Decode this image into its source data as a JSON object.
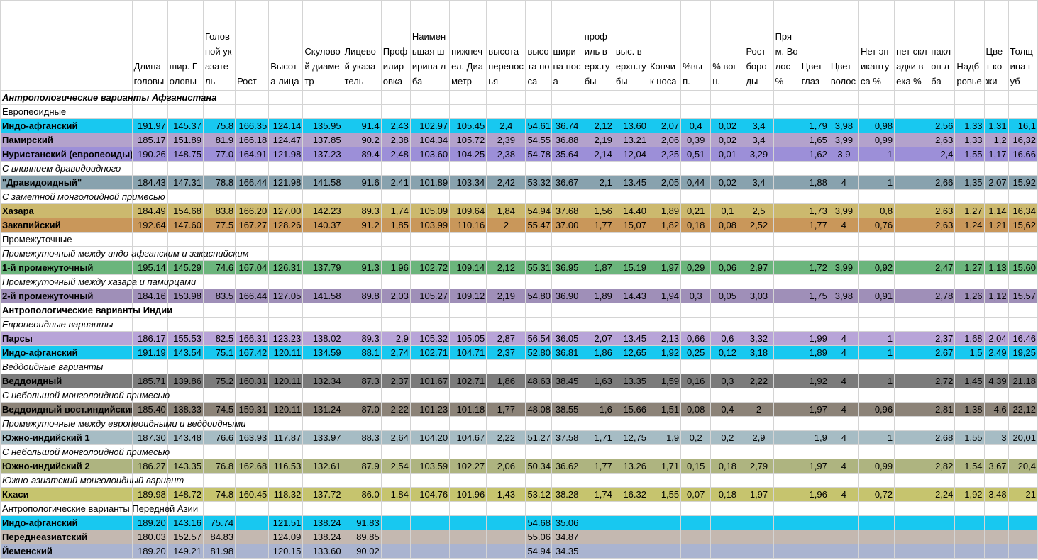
{
  "headers": [
    "",
    "Длина головы",
    "шир. Головы",
    "Головной указатель",
    "Рост",
    "Высота лица",
    "Скуловой диаметр",
    "Лицевой указатель",
    "Профилировка",
    "Наименьшая ширина лба",
    "нижнечел. Диаметр",
    "высота переносья",
    "высота носа",
    "ширина носа",
    "профиль верх.губы",
    "выс. верхн.губы",
    "Кончик носа",
    "%вып.",
    "% вогн.",
    "Рост бороды",
    "Прям. Волос %",
    "Цвет глаз",
    "Цвет волос",
    "Нет эпикантуса %",
    "нет складки века %",
    "наклон лба",
    "Надбровье",
    "Цвет кожи",
    "Толщина губ"
  ],
  "rows": [
    {
      "kind": "title",
      "label": "Антропологические варианты Афганистана"
    },
    {
      "kind": "plain",
      "label": "Европеоидные"
    },
    {
      "kind": "data",
      "color": "#18c8f0",
      "cells": [
        "Индо-афганский",
        "191.97",
        "145.37",
        "75.8",
        "166.35",
        "124.14",
        "135.95",
        "91.4",
        "2,43",
        "102.97",
        "105.45",
        "2,4",
        "54.61",
        "36.74",
        "2,12",
        "13.60",
        "2,07",
        "0,4",
        "0,02",
        "3,4",
        "",
        "1,79",
        "3,98",
        "0,98",
        "",
        "2,56",
        "1,33",
        "1,31",
        "16,1"
      ]
    },
    {
      "kind": "data",
      "color": "#b3a2cc",
      "cells": [
        "Памирский",
        "185.17",
        "151.89",
        "81.9",
        "166.18",
        "124.47",
        "137.85",
        "90.2",
        "2,38",
        "104.34",
        "105.72",
        "2,39",
        "54.55",
        "36.88",
        "2,19",
        "13.21",
        "2,06",
        "0,39",
        "0,02",
        "3,4",
        "",
        "1,65",
        "3,99",
        "0,99",
        "",
        "2,63",
        "1,33",
        "1,2",
        "16,32"
      ]
    },
    {
      "kind": "data",
      "color": "#9c8fd8",
      "cells": [
        "Нуристанский (европеоиды)",
        "190.26",
        "148.75",
        "77.0",
        "164.91",
        "121.98",
        "137.23",
        "89.4",
        "2,48",
        "103.60",
        "104.25",
        "2,38",
        "54.78",
        "35.64",
        "2,14",
        "12,04",
        "2,25",
        "0,51",
        "0,01",
        "3,29",
        "",
        "1,62",
        "3,9",
        "1",
        "",
        "2,4",
        "1,55",
        "1,17",
        "16.66"
      ]
    },
    {
      "kind": "italic",
      "label": "С влиянием дравидоидного"
    },
    {
      "kind": "data",
      "color": "#88a2ae",
      "cells": [
        "\"Дравидоидный\"",
        "184.43",
        "147.31",
        "78.8",
        "166.44",
        "121.98",
        "141.58",
        "91.6",
        "2,41",
        "101.89",
        "103.34",
        "2,42",
        "53.32",
        "36.67",
        "2,1",
        "13.45",
        "2,05",
        "0,44",
        "0,02",
        "3,4",
        "",
        "1,88",
        "4",
        "1",
        "",
        "2,66",
        "1,35",
        "2,07",
        "15.92"
      ]
    },
    {
      "kind": "italic",
      "label": "С заметной монголоидной примесью"
    },
    {
      "kind": "data",
      "color": "#ccb96e",
      "cells": [
        "Хазара",
        "184.49",
        "154.68",
        "83.8",
        "166.20",
        "127.00",
        "142.23",
        "89.3",
        "1,74",
        "105.09",
        "109.64",
        "1,84",
        "54.94",
        "37.68",
        "1,56",
        "14.40",
        "1,89",
        "0,21",
        "0,1",
        "2,5",
        "",
        "1,73",
        "3,99",
        "0,8",
        "",
        "2,63",
        "1,27",
        "1,14",
        "16,34"
      ]
    },
    {
      "kind": "data",
      "color": "#c9975a",
      "cells": [
        "Закапийский",
        "192.64",
        "147.60",
        "77.5",
        "167.27",
        "128.26",
        "140.37",
        "91.2",
        "1,85",
        "103.99",
        "110.16",
        "2",
        "55.47",
        "37.00",
        "1,77",
        "15,07",
        "1,82",
        "0,18",
        "0,08",
        "2,52",
        "",
        "1,77",
        "4",
        "0,76",
        "",
        "2,63",
        "1,24",
        "1,21",
        "15,62"
      ]
    },
    {
      "kind": "plain",
      "label": "Промежуточные"
    },
    {
      "kind": "italic",
      "label": "Промежуточный между индо-афганским и закаспийским"
    },
    {
      "kind": "data",
      "color": "#6bb57c",
      "cells": [
        "1-й промежуточный",
        "195.14",
        "145.29",
        "74.6",
        "167.04",
        "126.31",
        "137.79",
        "91.3",
        "1,96",
        "102.72",
        "109.14",
        "2,12",
        "55.31",
        "36.95",
        "1,87",
        "15.19",
        "1,97",
        "0,29",
        "0,06",
        "2,97",
        "",
        "1,72",
        "3,99",
        "0,92",
        "",
        "2,47",
        "1,27",
        "1,13",
        "15.60"
      ]
    },
    {
      "kind": "italic",
      "label": "Промежуточный между хазара и памирцами"
    },
    {
      "kind": "data",
      "color": "#9f8fb8",
      "cells": [
        "2-й промежуточный",
        "184.16",
        "153.98",
        "83.5",
        "166.44",
        "127.05",
        "141.58",
        "89.8",
        "2,03",
        "105.27",
        "109.12",
        "2,19",
        "54.80",
        "36.90",
        "1,89",
        "14.43",
        "1,94",
        "0,3",
        "0,05",
        "3,03",
        "",
        "1,75",
        "3,98",
        "0,91",
        "",
        "2,78",
        "1,26",
        "1,12",
        "15.57"
      ]
    },
    {
      "kind": "section",
      "label": "Антропологические варианты Индии"
    },
    {
      "kind": "italic",
      "label": "Европеоидные варианты"
    },
    {
      "kind": "data",
      "color": "#b8a4d8",
      "cells": [
        "Парсы",
        "186.17",
        "155.53",
        "82.5",
        "166.31",
        "123.23",
        "138.02",
        "89.3",
        "2,9",
        "105.32",
        "105.05",
        "2,87",
        "56.54",
        "36.05",
        "2,07",
        "13.45",
        "2,13",
        "0,66",
        "0,6",
        "3,32",
        "",
        "1,99",
        "4",
        "1",
        "",
        "2,37",
        "1,68",
        "2,04",
        "16.46"
      ]
    },
    {
      "kind": "data",
      "color": "#18c8f0",
      "cells": [
        "Индо-афганский",
        "191.19",
        "143.54",
        "75.1",
        "167.42",
        "120.11",
        "134.59",
        "88.1",
        "2,74",
        "102.71",
        "104.71",
        "2,37",
        "52.80",
        "36.81",
        "1,86",
        "12,65",
        "1,92",
        "0,25",
        "0,12",
        "3,18",
        "",
        "1,89",
        "4",
        "1",
        "",
        "2,67",
        "1,5",
        "2,49",
        "19,25"
      ]
    },
    {
      "kind": "italic",
      "label": "Веддоидные варианты"
    },
    {
      "kind": "data",
      "color": "#7b7b7b",
      "cells": [
        "Веддоидный",
        "185.71",
        "139.86",
        "75.2",
        "160.31",
        "120.11",
        "132.34",
        "87.3",
        "2,37",
        "101.67",
        "102.71",
        "1,86",
        "48.63",
        "38.45",
        "1,63",
        "13.35",
        "1,59",
        "0,16",
        "0,3",
        "2,22",
        "",
        "1,92",
        "4",
        "1",
        "",
        "2,72",
        "1,45",
        "4,39",
        "21.18"
      ]
    },
    {
      "kind": "italic",
      "label": "С небольшой монголоидной примесью"
    },
    {
      "kind": "data",
      "color": "#8c8378",
      "cells": [
        "Веддоидный вост.индийский",
        "185.40",
        "138.33",
        "74.5",
        "159.31",
        "120.11",
        "131.24",
        "87.0",
        "2,22",
        "101.23",
        "101.18",
        "1,77",
        "48.08",
        "38.55",
        "1,6",
        "15.66",
        "1,51",
        "0,08",
        "0,4",
        "2",
        "",
        "1,97",
        "4",
        "0,96",
        "",
        "2,81",
        "1,38",
        "4,6",
        "22,12"
      ]
    },
    {
      "kind": "italic",
      "label": "Промежуточные между европеоидными и веддоидными"
    },
    {
      "kind": "data",
      "color": "#a6bcc4",
      "cells": [
        "Южно-индийский 1",
        "187.30",
        "143.48",
        "76.6",
        "163.93",
        "117.87",
        "133.97",
        "88.3",
        "2,64",
        "104.20",
        "104.67",
        "2,22",
        "51.27",
        "37.58",
        "1,71",
        "12,75",
        "1,9",
        "0,2",
        "0,2",
        "2,9",
        "",
        "1,9",
        "4",
        "1",
        "",
        "2,68",
        "1,55",
        "3",
        "20,01"
      ]
    },
    {
      "kind": "italic",
      "label": "С небольшой монголоидной примесью"
    },
    {
      "kind": "data",
      "color": "#aeb480",
      "cells": [
        "Южно-индийский 2",
        "186.27",
        "143.35",
        "76.8",
        "162.68",
        "116.53",
        "132.61",
        "87.9",
        "2,54",
        "103.59",
        "102.27",
        "2,06",
        "50.34",
        "36.62",
        "1,77",
        "13.26",
        "1,71",
        "0,15",
        "0,18",
        "2,79",
        "",
        "1,97",
        "4",
        "0,99",
        "",
        "2,82",
        "1,54",
        "3,67",
        "20,4"
      ]
    },
    {
      "kind": "italic",
      "label": "Южно-азиатский монголоидный вариант"
    },
    {
      "kind": "data",
      "color": "#c6c46e",
      "cells": [
        "Кхаси",
        "189.98",
        "148.72",
        "74.8",
        "160.45",
        "118.32",
        "137.72",
        "86.0",
        "1,84",
        "104.76",
        "101.96",
        "1,43",
        "53.12",
        "38.28",
        "1,74",
        "16.32",
        "1,55",
        "0,07",
        "0,18",
        "1,97",
        "",
        "1,96",
        "4",
        "0,72",
        "",
        "2,24",
        "1,92",
        "3,48",
        "21"
      ]
    },
    {
      "kind": "plain",
      "label": "Антропологические варианты Передней Азии"
    },
    {
      "kind": "data",
      "color": "#18c8f0",
      "cells": [
        "Индо-афганский",
        "189.20",
        "143.16",
        "75.74",
        "",
        "121.51",
        "138.24",
        "91.83",
        "",
        "",
        "",
        "",
        "54.68",
        "35.06",
        "",
        "",
        "",
        "",
        "",
        "",
        "",
        "",
        "",
        "",
        "",
        "",
        "",
        "",
        ""
      ]
    },
    {
      "kind": "data",
      "color": "#c4b8b0",
      "cells": [
        "Переднеазиатский",
        "180.03",
        "152.57",
        "84.83",
        "",
        "124.09",
        "138.24",
        "89.85",
        "",
        "",
        "",
        "",
        "55.06",
        "34.87",
        "",
        "",
        "",
        "",
        "",
        "",
        "",
        "",
        "",
        "",
        "",
        "",
        "",
        "",
        ""
      ]
    },
    {
      "kind": "data",
      "color": "#aab4d0",
      "cells": [
        "Йеменский",
        "189.20",
        "149.21",
        "81.98",
        "",
        "120.15",
        "133.60",
        "90.02",
        "",
        "",
        "",
        "",
        "54.94",
        "34.35",
        "",
        "",
        "",
        "",
        "",
        "",
        "",
        "",
        "",
        "",
        "",
        "",
        "",
        "",
        ""
      ]
    }
  ]
}
